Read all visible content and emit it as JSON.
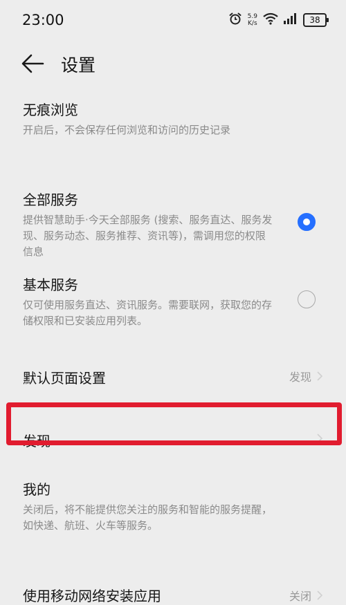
{
  "status_bar": {
    "time": "23:00",
    "net_speed_value": "5.9",
    "net_speed_unit": "K/s",
    "battery": "38"
  },
  "header": {
    "title": "设置"
  },
  "settings": {
    "incognito": {
      "title": "无痕浏览",
      "desc": "开启后，不会保存任何浏览和访问的历史记录"
    },
    "full_service": {
      "title": "全部服务",
      "desc": "提供智慧助手·今天全部服务 (搜索、服务直达、服务发现、服务动态、服务推荐、资讯等)，需调用您的权限信息",
      "selected": true
    },
    "basic_service": {
      "title": "基本服务",
      "desc": "仅可使用服务直达、资讯服务。需要联网，获取您的存储权限和已安装应用列表。",
      "selected": false
    },
    "default_page": {
      "title": "默认页面设置",
      "value": "发现"
    },
    "discover": {
      "title": "发现"
    },
    "mine": {
      "title": "我的",
      "desc": "关闭后，将不能提供您关注的服务和智能的服务提醒，如快递、航班、火车等服务。"
    },
    "mobile_install": {
      "title": "使用移动网络安装应用",
      "value": "关闭"
    }
  },
  "colors": {
    "accent": "#256fff",
    "highlight": "#e11c2f",
    "background": "#ededed"
  }
}
